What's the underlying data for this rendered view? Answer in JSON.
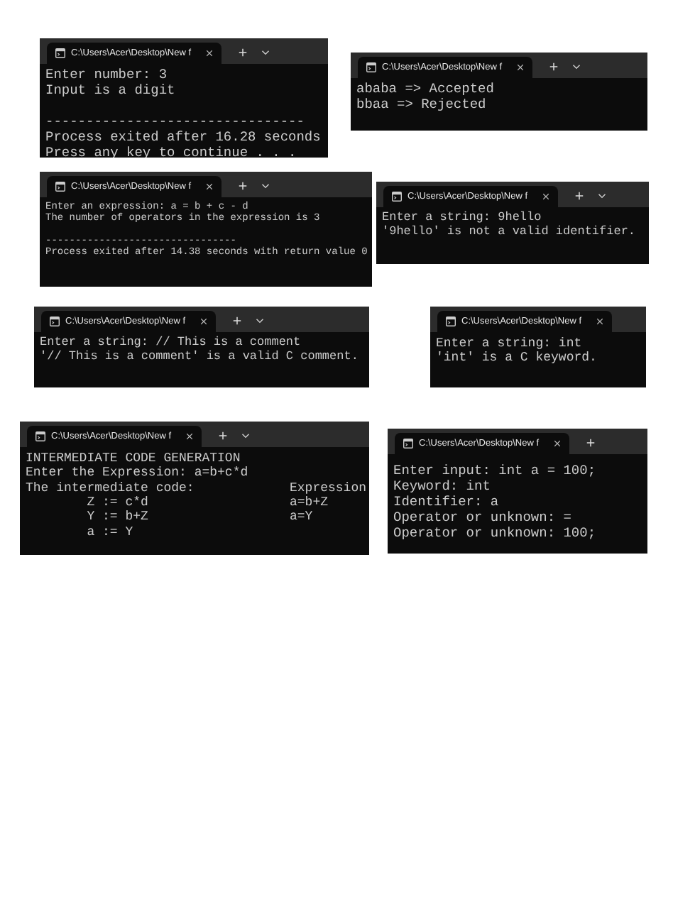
{
  "windows": [
    {
      "title": "C:\\Users\\Acer\\Desktop\\New f",
      "close": true,
      "plus": true,
      "chevron": true,
      "lines": [
        {
          "text": "Enter number: 3"
        },
        {
          "text": "Input is a digit"
        },
        {
          "kind": "blank"
        },
        {
          "text": "--------------------------------"
        },
        {
          "text": "Process exited after 16.28 seconds"
        },
        {
          "text": "Press any key to continue . . ."
        }
      ]
    },
    {
      "title": "C:\\Users\\Acer\\Desktop\\New f",
      "close": true,
      "plus": true,
      "chevron": true,
      "lines": [
        {
          "text": "ababa => Accepted"
        },
        {
          "text": "bbaa => Rejected"
        }
      ]
    },
    {
      "title": "C:\\Users\\Acer\\Desktop\\New f",
      "close": true,
      "plus": true,
      "chevron": true,
      "lines": [
        {
          "text": "Enter an expression: a = b + c - d"
        },
        {
          "text": "The number of operators in the expression is 3"
        },
        {
          "kind": "blank"
        },
        {
          "text": "--------------------------------"
        },
        {
          "text": "Process exited after 14.38 seconds with return value 0"
        }
      ]
    },
    {
      "title": "C:\\Users\\Acer\\Desktop\\New f",
      "close": true,
      "plus": true,
      "chevron": true,
      "lines": [
        {
          "text": "Enter a string: 9hello"
        },
        {
          "text": "'9hello' is not a valid identifier."
        }
      ]
    },
    {
      "title": "C:\\Users\\Acer\\Desktop\\New f",
      "close": true,
      "plus": true,
      "chevron": true,
      "lines": [
        {
          "text": "Enter a string: // This is a comment"
        },
        {
          "text": "'// This is a comment' is a valid C comment."
        }
      ]
    },
    {
      "title": "C:\\Users\\Acer\\Desktop\\New f",
      "close": true,
      "lines": [
        {
          "text": "Enter a string: int"
        },
        {
          "text": "'int' is a C keyword."
        }
      ]
    },
    {
      "title": "C:\\Users\\Acer\\Desktop\\New f",
      "close": true,
      "plus": true,
      "chevron": true,
      "lines": [
        {
          "text": "INTERMEDIATE CODE GENERATION"
        },
        {
          "text": "Enter the Expression: a=b+c*d"
        },
        {
          "text": "The intermediate code:",
          "aside": "Expression"
        },
        {
          "text": "        Z := c*d",
          "aside": "a=b+Z"
        },
        {
          "text": "        Y := b+Z",
          "aside": "a=Y"
        },
        {
          "text": "        a := Y"
        }
      ]
    },
    {
      "title": "C:\\Users\\Acer\\Desktop\\New f",
      "close": true,
      "plus": true,
      "lines": [
        {
          "text": "Enter input: int a = 100;"
        },
        {
          "text": "Keyword: int"
        },
        {
          "text": "Identifier: a"
        },
        {
          "text": "Operator or unknown: ="
        },
        {
          "text": "Operator or unknown: 100;"
        }
      ]
    }
  ]
}
